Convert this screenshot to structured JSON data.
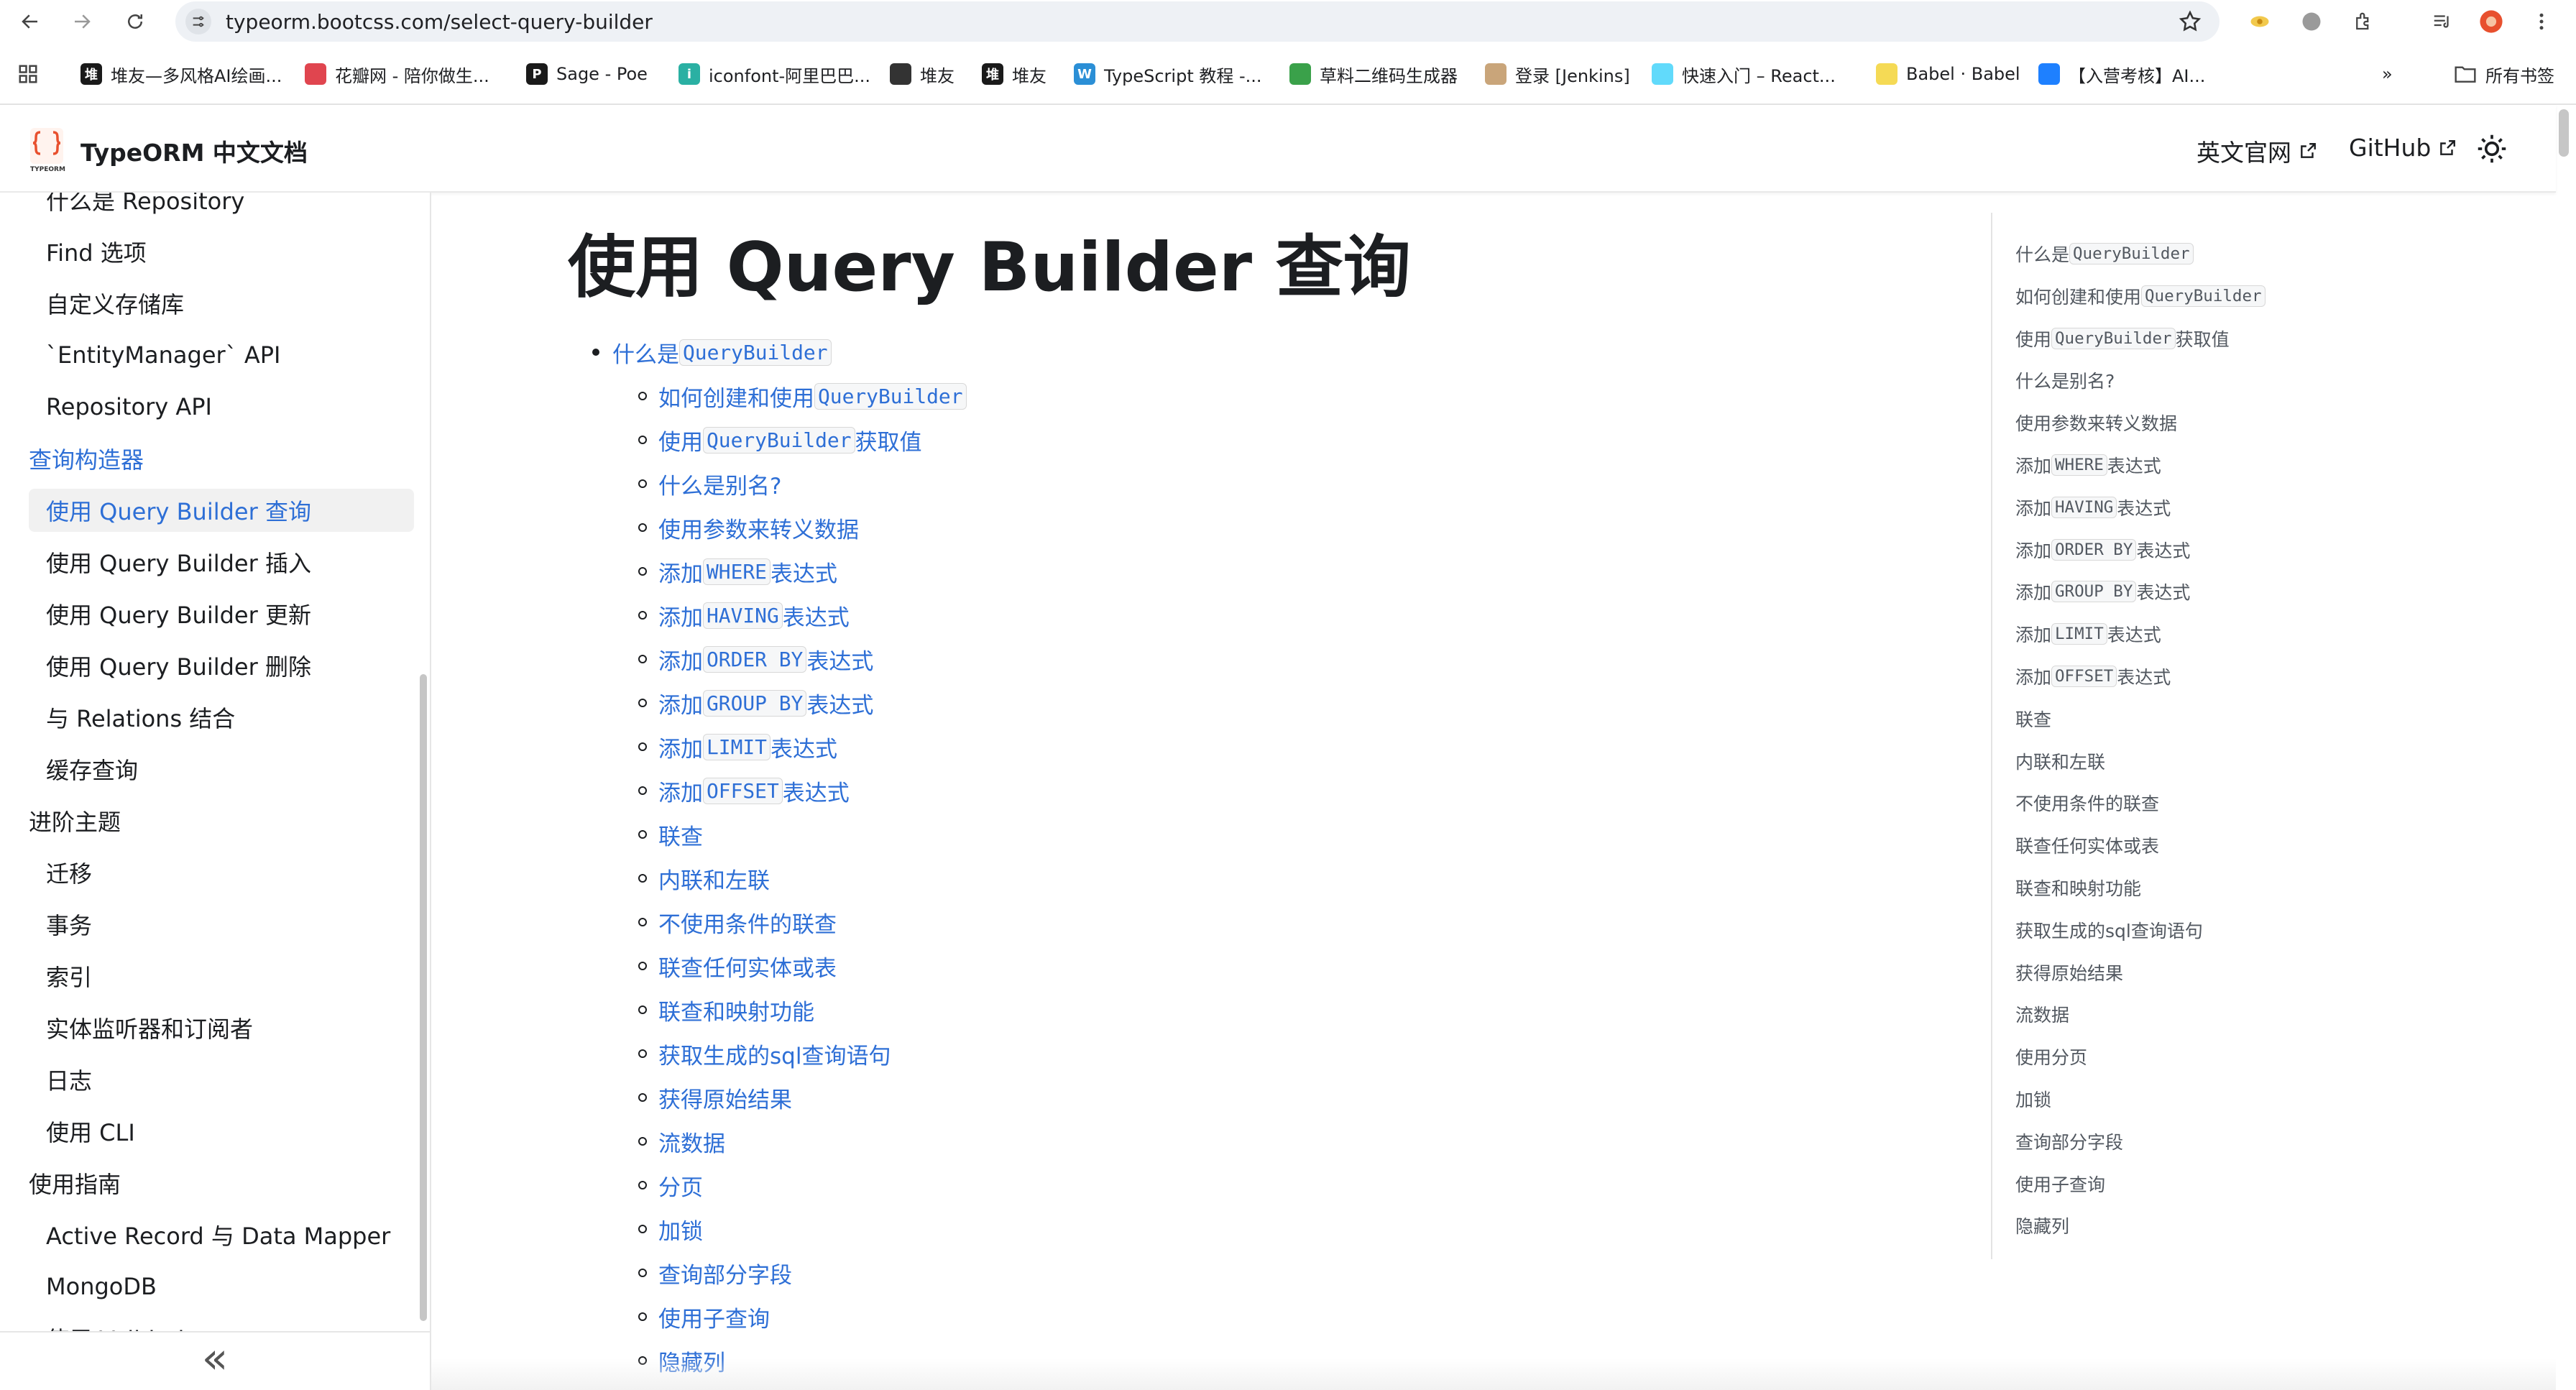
{
  "browser": {
    "url": "typeorm.bootcss.com/select-query-builder",
    "bookmarks": [
      {
        "label": "堆友—多风格AI绘画...",
        "icon": "duiyou-icon",
        "color": "#1a1a1a",
        "glyph": "堆"
      },
      {
        "label": "花瓣网 - 陪你做生...",
        "icon": "huaban-icon",
        "color": "#e0454f",
        "glyph": ""
      },
      {
        "label": "Sage - Poe",
        "icon": "poe-icon",
        "color": "#1a1a1a",
        "glyph": "P"
      },
      {
        "label": "iconfont-阿里巴巴...",
        "icon": "iconfont-icon",
        "color": "#2ab0a3",
        "glyph": "i"
      },
      {
        "label": "堆友",
        "icon": "globe-icon",
        "color": "#333333",
        "glyph": ""
      },
      {
        "label": "堆友",
        "icon": "duiyou-icon",
        "color": "#1a1a1a",
        "glyph": "堆"
      },
      {
        "label": "TypeScript 教程 -...",
        "icon": "w3-icon",
        "color": "#2b8fd6",
        "glyph": "W"
      },
      {
        "label": "草料二维码生成器",
        "icon": "qr-icon",
        "color": "#3aa14a",
        "glyph": ""
      },
      {
        "label": "登录 [Jenkins]",
        "icon": "jenkins-icon",
        "color": "#c9a57a",
        "glyph": ""
      },
      {
        "label": "快速入门 – React...",
        "icon": "react-icon",
        "color": "#61dafb",
        "glyph": ""
      },
      {
        "label": "Babel · Babel",
        "icon": "babel-icon",
        "color": "#f5da55",
        "glyph": ""
      },
      {
        "label": "【入营考核】AI...",
        "icon": "juejin-icon",
        "color": "#1e80ff",
        "glyph": ""
      }
    ],
    "all_bookmarks": "所有书签",
    "more_bookmarks": "»"
  },
  "navbar": {
    "brand": "TypeORM 中文文档",
    "links": [
      "英文官网",
      "GitHub"
    ]
  },
  "sidebar": {
    "items": [
      {
        "label": "什么是 Repository",
        "kind": "child"
      },
      {
        "label": "Find 选项",
        "kind": "child"
      },
      {
        "label": "自定义存储库",
        "kind": "child"
      },
      {
        "label": "`EntityManager` API",
        "kind": "child"
      },
      {
        "label": "Repository API",
        "kind": "child"
      },
      {
        "label": "查询构造器",
        "kind": "cat-active"
      },
      {
        "label": "使用 Query Builder 查询",
        "kind": "active"
      },
      {
        "label": "使用 Query Builder 插入",
        "kind": "child"
      },
      {
        "label": "使用 Query Builder 更新",
        "kind": "child"
      },
      {
        "label": "使用 Query Builder 删除",
        "kind": "child"
      },
      {
        "label": "与 Relations 结合",
        "kind": "child"
      },
      {
        "label": "缓存查询",
        "kind": "child"
      },
      {
        "label": "进阶主题",
        "kind": "cat"
      },
      {
        "label": "迁移",
        "kind": "child"
      },
      {
        "label": "事务",
        "kind": "child"
      },
      {
        "label": "索引",
        "kind": "child"
      },
      {
        "label": "实体监听器和订阅者",
        "kind": "child"
      },
      {
        "label": "日志",
        "kind": "child"
      },
      {
        "label": "使用 CLI",
        "kind": "child"
      },
      {
        "label": "使用指南",
        "kind": "cat"
      },
      {
        "label": "Active Record 与 Data Mapper",
        "kind": "child"
      },
      {
        "label": "MongoDB",
        "kind": "child"
      },
      {
        "label": "使用 Validation",
        "kind": "child"
      }
    ],
    "collapse_glyph": "«"
  },
  "main": {
    "title": "使用 Query Builder 查询",
    "toc": [
      {
        "level": 1,
        "pre": "什么是",
        "code": "QueryBuilder",
        "post": ""
      },
      {
        "level": 2,
        "pre": "如何创建和使用",
        "code": "QueryBuilder",
        "post": ""
      },
      {
        "level": 2,
        "pre": "使用",
        "code": "QueryBuilder",
        "post": "获取值"
      },
      {
        "level": 2,
        "pre": "什么是别名?",
        "code": "",
        "post": ""
      },
      {
        "level": 2,
        "pre": "使用参数来转义数据",
        "code": "",
        "post": ""
      },
      {
        "level": 2,
        "pre": "添加",
        "code": "WHERE",
        "post": "表达式"
      },
      {
        "level": 2,
        "pre": "添加",
        "code": "HAVING",
        "post": "表达式"
      },
      {
        "level": 2,
        "pre": "添加",
        "code": "ORDER BY",
        "post": "表达式"
      },
      {
        "level": 2,
        "pre": "添加",
        "code": "GROUP BY",
        "post": "表达式"
      },
      {
        "level": 2,
        "pre": "添加",
        "code": "LIMIT",
        "post": "表达式"
      },
      {
        "level": 2,
        "pre": "添加",
        "code": "OFFSET",
        "post": "表达式"
      },
      {
        "level": 2,
        "pre": "联查",
        "code": "",
        "post": ""
      },
      {
        "level": 2,
        "pre": "内联和左联",
        "code": "",
        "post": ""
      },
      {
        "level": 2,
        "pre": "不使用条件的联查",
        "code": "",
        "post": ""
      },
      {
        "level": 2,
        "pre": "联查任何实体或表",
        "code": "",
        "post": ""
      },
      {
        "level": 2,
        "pre": "联查和映射功能",
        "code": "",
        "post": ""
      },
      {
        "level": 2,
        "pre": "获取生成的sql查询语句",
        "code": "",
        "post": ""
      },
      {
        "level": 2,
        "pre": "获得原始结果",
        "code": "",
        "post": ""
      },
      {
        "level": 2,
        "pre": "流数据",
        "code": "",
        "post": ""
      },
      {
        "level": 2,
        "pre": "分页",
        "code": "",
        "post": ""
      },
      {
        "level": 2,
        "pre": "加锁",
        "code": "",
        "post": ""
      },
      {
        "level": 2,
        "pre": "查询部分字段",
        "code": "",
        "post": ""
      },
      {
        "level": 2,
        "pre": "使用子查询",
        "code": "",
        "post": ""
      },
      {
        "level": 2,
        "pre": "隐藏列",
        "code": "",
        "post": ""
      }
    ]
  },
  "right_toc": [
    {
      "pre": "什么是",
      "code": "QueryBuilder",
      "post": ""
    },
    {
      "pre": "如何创建和使用",
      "code": "QueryBuilder",
      "post": ""
    },
    {
      "pre": "使用",
      "code": "QueryBuilder",
      "post": "获取值"
    },
    {
      "pre": "什么是别名?",
      "code": "",
      "post": ""
    },
    {
      "pre": "使用参数来转义数据",
      "code": "",
      "post": ""
    },
    {
      "pre": "添加",
      "code": "WHERE",
      "post": "表达式"
    },
    {
      "pre": "添加",
      "code": "HAVING",
      "post": "表达式"
    },
    {
      "pre": "添加",
      "code": "ORDER BY",
      "post": "表达式"
    },
    {
      "pre": "添加",
      "code": "GROUP BY",
      "post": "表达式"
    },
    {
      "pre": "添加",
      "code": "LIMIT",
      "post": "表达式"
    },
    {
      "pre": "添加",
      "code": "OFFSET",
      "post": "表达式"
    },
    {
      "pre": "联查",
      "code": "",
      "post": ""
    },
    {
      "pre": "内联和左联",
      "code": "",
      "post": ""
    },
    {
      "pre": "不使用条件的联查",
      "code": "",
      "post": ""
    },
    {
      "pre": "联查任何实体或表",
      "code": "",
      "post": ""
    },
    {
      "pre": "联查和映射功能",
      "code": "",
      "post": ""
    },
    {
      "pre": "获取生成的sql查询语句",
      "code": "",
      "post": ""
    },
    {
      "pre": "获得原始结果",
      "code": "",
      "post": ""
    },
    {
      "pre": "流数据",
      "code": "",
      "post": ""
    },
    {
      "pre": "使用分页",
      "code": "",
      "post": ""
    },
    {
      "pre": "加锁",
      "code": "",
      "post": ""
    },
    {
      "pre": "查询部分字段",
      "code": "",
      "post": ""
    },
    {
      "pre": "使用子查询",
      "code": "",
      "post": ""
    },
    {
      "pre": "隐藏列",
      "code": "",
      "post": ""
    }
  ],
  "colors": {
    "link": "#2e6fd6",
    "text": "#1c1e21",
    "muted": "#525860"
  }
}
